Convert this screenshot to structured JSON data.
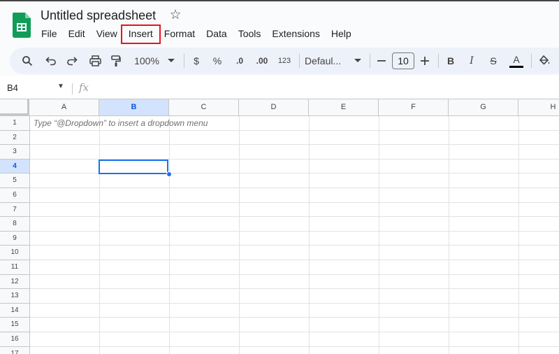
{
  "app": {
    "title": "Untitled spreadsheet",
    "accent": "#0f9d58",
    "highlight_color": "#e8141c"
  },
  "menu": [
    {
      "label": "File"
    },
    {
      "label": "Edit"
    },
    {
      "label": "View"
    },
    {
      "label": "Insert",
      "highlighted": true
    },
    {
      "label": "Format"
    },
    {
      "label": "Data"
    },
    {
      "label": "Tools"
    },
    {
      "label": "Extensions"
    },
    {
      "label": "Help"
    }
  ],
  "toolbar": {
    "zoom": "100%",
    "currency_label": "$",
    "percent_label": "%",
    "decrease_decimal_label": ".0",
    "increase_decimal_label": ".00",
    "number_format_label": "123",
    "font_family": "Defaul...",
    "font_size": "10",
    "bold_label": "B",
    "italic_label": "I",
    "strike_label": "S",
    "text_color_label": "A",
    "icons": [
      "search-icon",
      "undo-icon",
      "redo-icon",
      "print-icon",
      "paint-format-icon",
      "fill-color-icon"
    ]
  },
  "formula_bar": {
    "cell_reference": "B4",
    "fx_label": "fx",
    "value": ""
  },
  "grid": {
    "columns": [
      "A",
      "B",
      "C",
      "D",
      "E",
      "F",
      "G",
      "H"
    ],
    "rows": [
      "1",
      "2",
      "3",
      "4",
      "5",
      "6",
      "7",
      "8",
      "9",
      "10",
      "11",
      "12",
      "13",
      "14",
      "15",
      "16",
      "17"
    ],
    "selected_column": "B",
    "selected_row": "4",
    "hint_text": "Type “@Dropdown”  to insert a dropdown menu"
  }
}
